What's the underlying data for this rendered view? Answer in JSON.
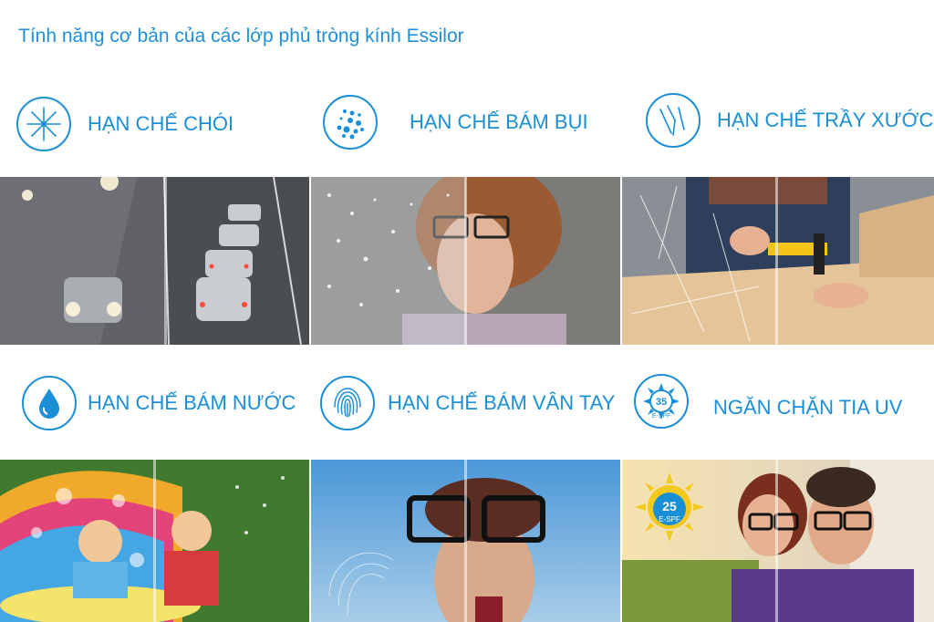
{
  "title": "Tính năng cơ bản của các lớp phủ tròng kính Essilor",
  "features": [
    {
      "label": "HẠN CHẾ CHÓI",
      "icon": "glare-star-icon"
    },
    {
      "label": "HẠN CHẾ BÁM BỤI",
      "icon": "dust-dots-icon"
    },
    {
      "label": "HẠN CHẾ TRẦY XƯỚC",
      "icon": "scratch-lines-icon"
    },
    {
      "label": "HẠN CHẾ BÁM NƯỚC",
      "icon": "water-drop-icon"
    },
    {
      "label": "HẠN CHẾ BÁM VÂN TAY",
      "icon": "fingerprint-icon"
    },
    {
      "label": "NGĂN CHẶN TIA UV",
      "icon": "sun-espf-icon"
    }
  ],
  "uv_icon_badge": {
    "number": "35",
    "text": "E-SPF"
  },
  "uv_photo_badge": {
    "number": "25",
    "text": "E-SPF"
  },
  "colors": {
    "accent": "#1b8fd6"
  }
}
